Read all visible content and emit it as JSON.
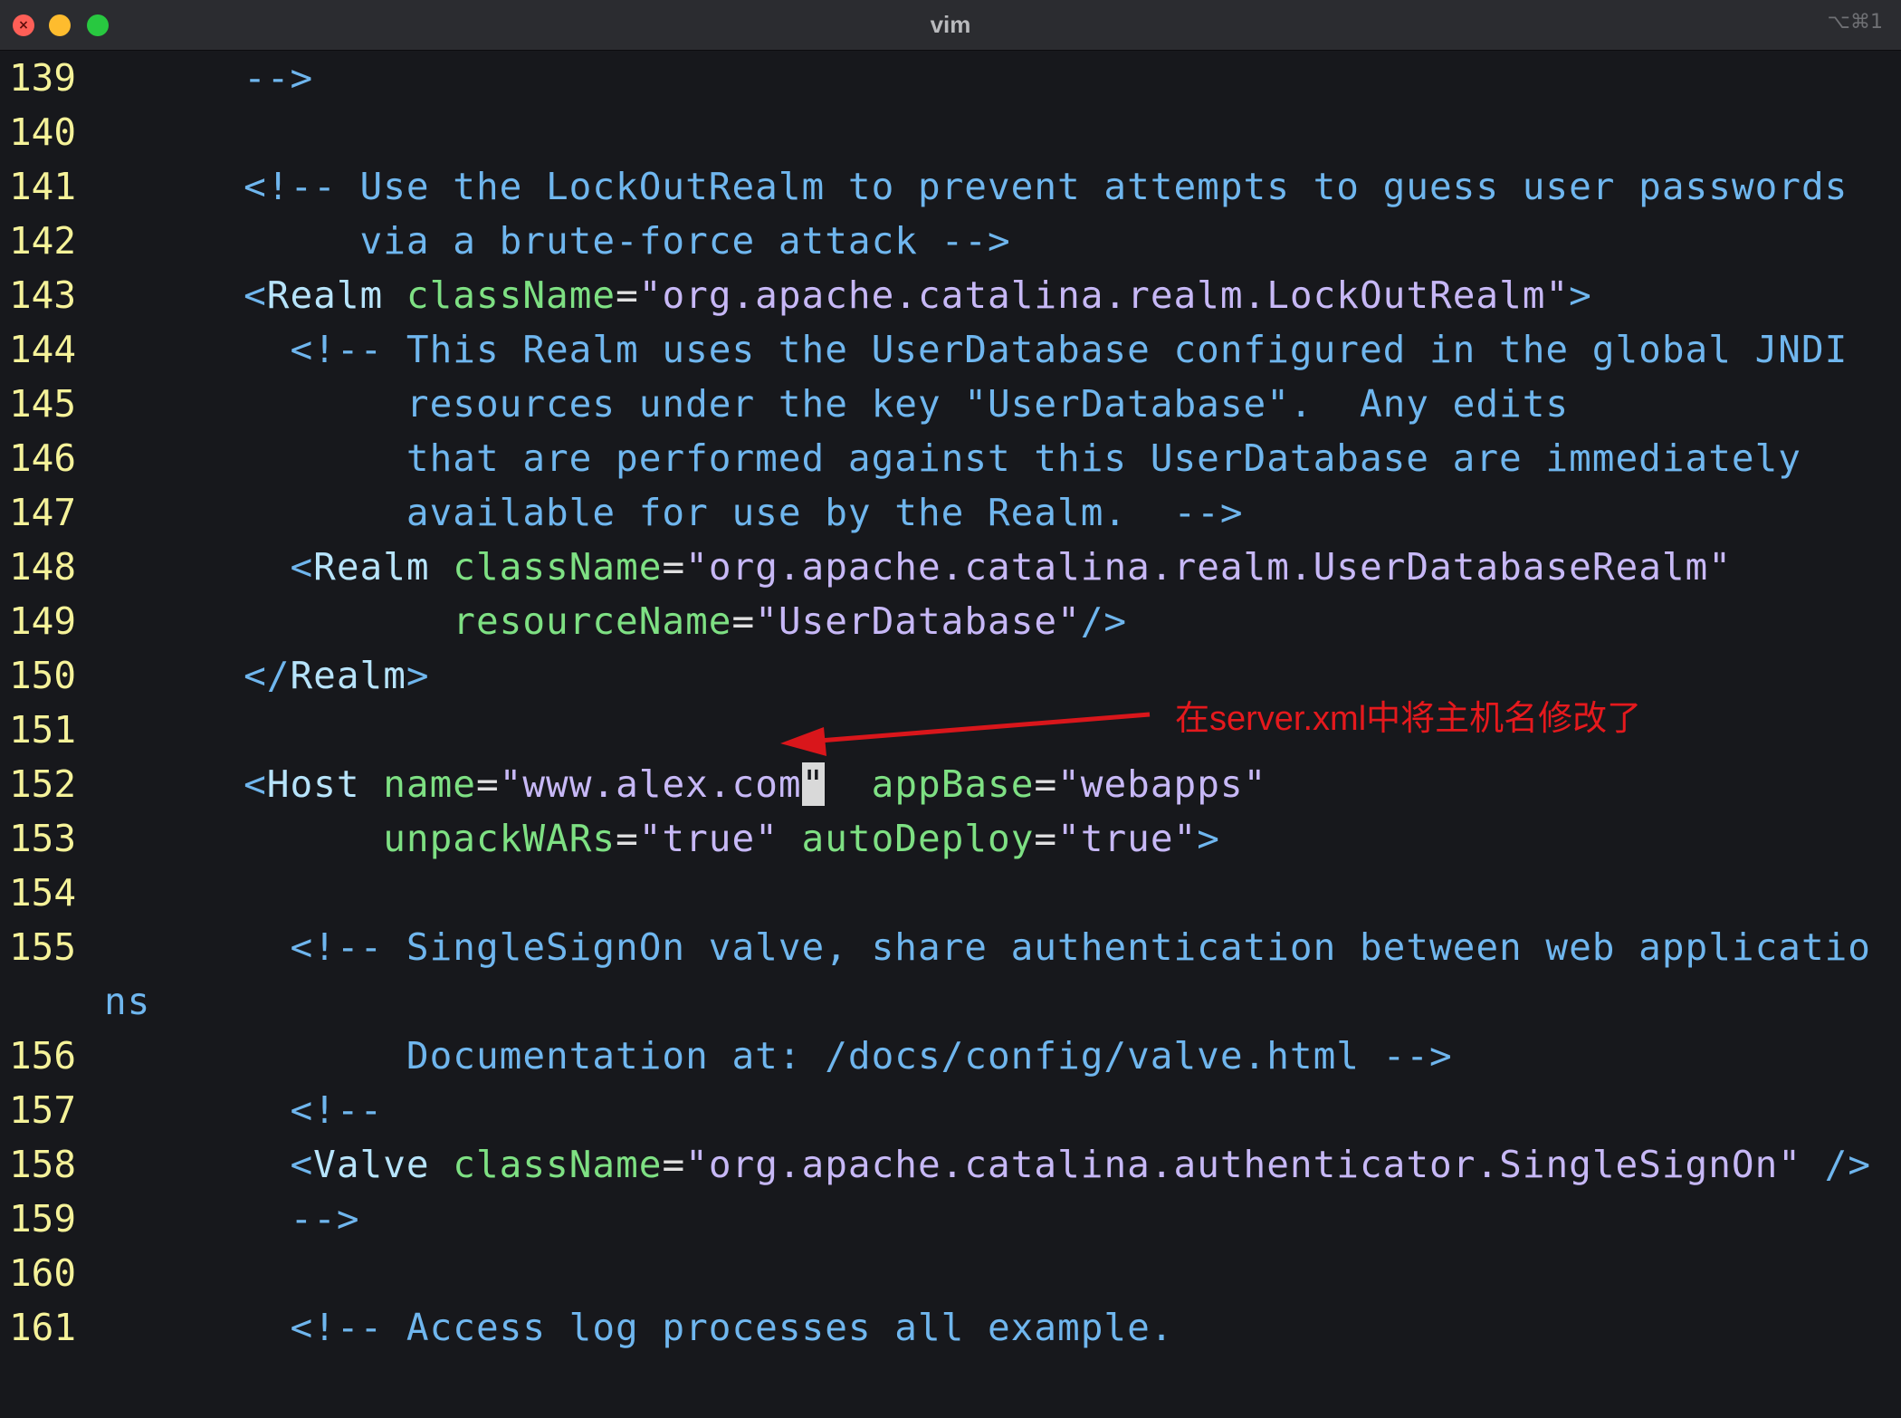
{
  "window": {
    "title": "vim",
    "shortcut": "⌥⌘1",
    "traffic_close_symbol": "×"
  },
  "colors": {
    "background": "#17181c",
    "line_number": "#f5f299",
    "comment": "#6fb6ee",
    "attribute": "#7ee083",
    "string": "#c7b8f6",
    "annotation": "#e5191d"
  },
  "editor": {
    "lines": [
      {
        "num": "139",
        "code": "      -->"
      },
      {
        "num": "140",
        "code": ""
      },
      {
        "num": "141",
        "code": "      <!-- Use the LockOutRealm to prevent attempts to guess user passwords"
      },
      {
        "num": "142",
        "code": "           via a brute-force attack -->"
      },
      {
        "num": "143",
        "code": "      <Realm className=\"org.apache.catalina.realm.LockOutRealm\">"
      },
      {
        "num": "144",
        "code": "        <!-- This Realm uses the UserDatabase configured in the global JNDI"
      },
      {
        "num": "145",
        "code": "             resources under the key \"UserDatabase\".  Any edits"
      },
      {
        "num": "146",
        "code": "             that are performed against this UserDatabase are immediately"
      },
      {
        "num": "147",
        "code": "             available for use by the Realm.  -->"
      },
      {
        "num": "148",
        "code": "        <Realm className=\"org.apache.catalina.realm.UserDatabaseRealm\""
      },
      {
        "num": "149",
        "code": "               resourceName=\"UserDatabase\"/>"
      },
      {
        "num": "150",
        "code": "      </Realm>"
      },
      {
        "num": "151",
        "code": ""
      },
      {
        "num": "152",
        "code": "      <Host name=\"www.alex.com\"  appBase=\"webapps\""
      },
      {
        "num": "153",
        "code": "            unpackWARs=\"true\" autoDeploy=\"true\">"
      },
      {
        "num": "154",
        "code": ""
      },
      {
        "num": "155",
        "code": "        <!-- SingleSignOn valve, share authentication between web applicatio"
      },
      {
        "num": "",
        "code": "ns"
      },
      {
        "num": "156",
        "code": "             Documentation at: /docs/config/valve.html -->"
      },
      {
        "num": "157",
        "code": "        <!--"
      },
      {
        "num": "158",
        "code": "        <Valve className=\"org.apache.catalina.authenticator.SingleSignOn\" />"
      },
      {
        "num": "159",
        "code": "        -->"
      },
      {
        "num": "160",
        "code": ""
      },
      {
        "num": "161",
        "code": "        <!-- Access log processes all example."
      }
    ],
    "cursor": {
      "line": "152",
      "char": "\""
    }
  },
  "annotation": {
    "text": "在server.xml中将主机名修改了"
  }
}
